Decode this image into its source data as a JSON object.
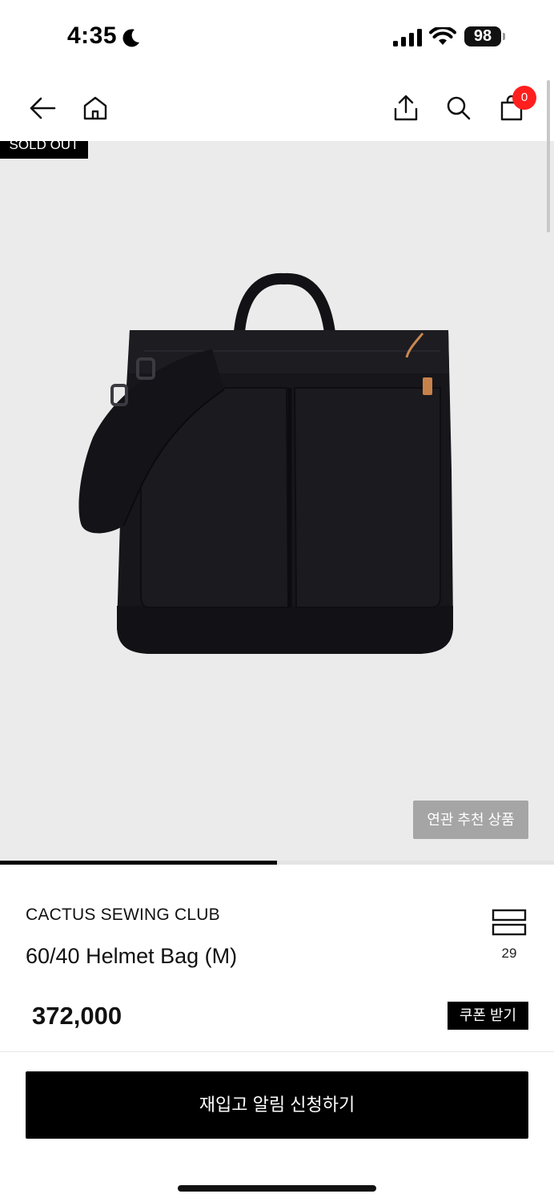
{
  "status_bar": {
    "time": "4:35",
    "battery": "98"
  },
  "header": {
    "cart_count": "0"
  },
  "gallery": {
    "badge": "SOLD OUT",
    "related_button": "연관 추천 상품",
    "slide_progress": 0.5
  },
  "product": {
    "brand": "CACTUS SEWING CLUB",
    "name": "60/40 Helmet Bag (M)",
    "like_count": "29",
    "price": "372,000",
    "coupon_button": "쿠폰 받기",
    "restock_button": "재입고 알림 신청하기"
  },
  "colors": {
    "accent": "#000000",
    "badge_red": "#ff1f1f",
    "gallery_bg": "#ebebeb",
    "related_bg": "#a5a5a5"
  },
  "icons": {
    "back": "back-arrow-icon",
    "home": "home-icon",
    "share": "share-icon",
    "search": "search-icon",
    "cart": "shopping-bag-icon",
    "list": "list-view-icon",
    "moon": "moon-icon",
    "signal": "signal-icon",
    "wifi": "wifi-icon"
  }
}
